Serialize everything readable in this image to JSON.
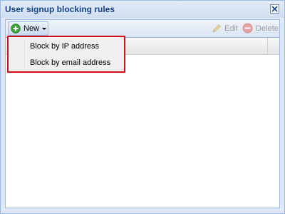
{
  "window": {
    "title": "User signup blocking rules"
  },
  "toolbar": {
    "new_label": "New",
    "edit_label": "Edit",
    "delete_label": "Delete"
  },
  "menu": {
    "items": [
      {
        "label": "Block by IP address"
      },
      {
        "label": "Block by email address"
      }
    ]
  },
  "colors": {
    "title_text": "#15428b",
    "border": "#99bbe8",
    "highlight_box": "#d0101c",
    "new_icon": "#3aa53a",
    "delete_icon": "#e07070"
  }
}
